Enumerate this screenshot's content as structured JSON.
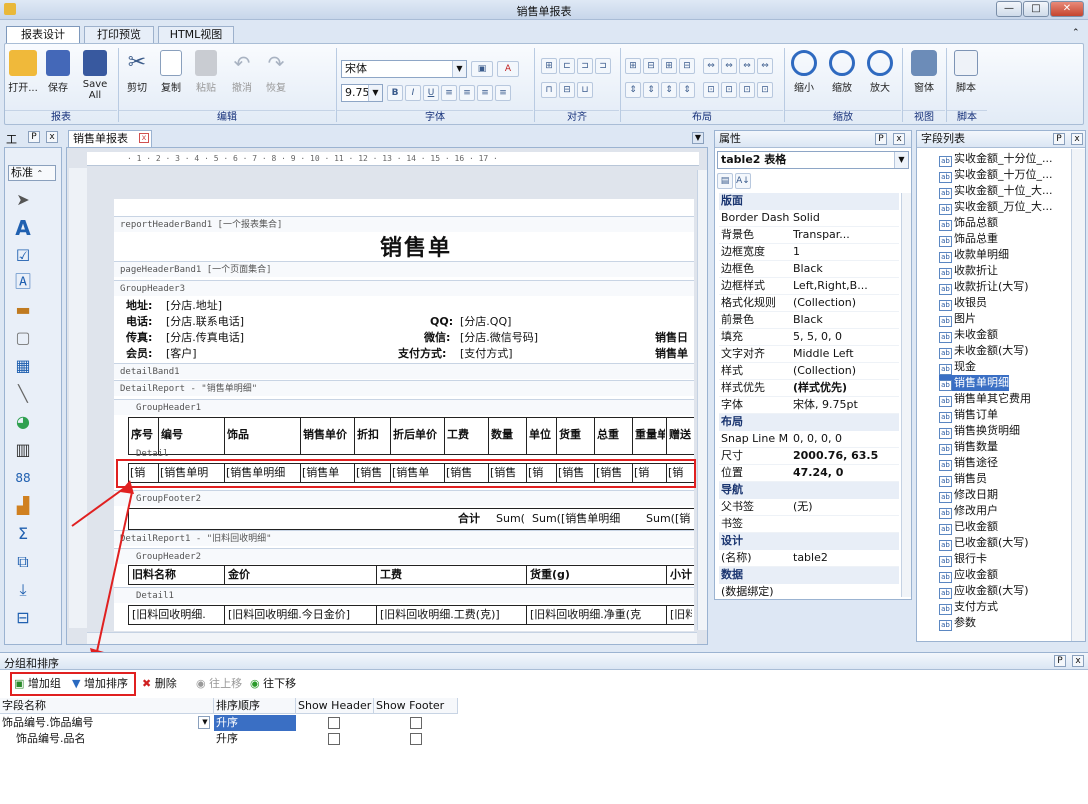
{
  "window": {
    "title": "销售单报表"
  },
  "tabs": [
    "报表设计",
    "打印预览",
    "HTML视图"
  ],
  "ribbon": {
    "open": "打开...",
    "save": "保存",
    "save_all": "Save All",
    "cut": "剪切",
    "copy": "复制",
    "paste": "粘贴",
    "undo": "撤消",
    "redo": "恢复",
    "font_name": "宋体",
    "font_size": "9.75",
    "bold": "B",
    "italic": "I",
    "underline": "U",
    "zoom_out": "缩小",
    "zoom": "缩放",
    "zoom_in": "放大",
    "window_btn": "窗体",
    "script": "脚本",
    "groups": {
      "report": "报表",
      "edit": "编辑",
      "font": "字体",
      "align": "对齐",
      "layout": "布局",
      "zoom": "缩放",
      "view": "视图",
      "script": "脚本"
    }
  },
  "doc_tab": "销售单报表",
  "toolbox": {
    "header": "工",
    "label": "标准"
  },
  "ruler": "· 1 · 2 · 3 · 4 · 5 · 6 · 7 · 8 · 9 · 10 · 11 · 12 · 13 · 14 · 15 · 16 · 17 ·",
  "bands": {
    "report_header": "reportHeaderBand1 [一个报表集合]",
    "page_header": "pageHeaderBand1 [一个页面集合]",
    "group_header3": "GroupHeader3",
    "detail_band": "detailBand1",
    "detail_report": "DetailReport - \"销售单明细\"",
    "group_header1": "GroupHeader1",
    "detail": "Detail",
    "group_footer2": "GroupFooter2",
    "detail_report1": "DetailReport1 - \"旧料回收明细\"",
    "group_header2": "GroupHeader2",
    "detail1": "Detail1"
  },
  "report": {
    "title": "销售单",
    "addr_label": "地址:",
    "addr_val": "[分店.地址]",
    "tel_label": "电话:",
    "tel_val": "[分店.联系电话]",
    "fax_label": "传真:",
    "fax_val": "[分店.传真电话]",
    "member_label": "会员:",
    "member_val": "[客户]",
    "qq_label": "QQ:",
    "qq_val": "[分店.QQ]",
    "wechat_label": "微信:",
    "wechat_val": "[分店.微信号码]",
    "pay_label": "支付方式:",
    "pay_val": "[支付方式]",
    "sale_date": "销售日",
    "sale_no": "销售单",
    "cols": [
      "序号",
      "编号",
      "饰品",
      "销售单价",
      "折扣",
      "折后单价",
      "工费",
      "数量",
      "单位",
      "货重",
      "总重",
      "重量单位",
      "赠送"
    ],
    "detail_cells": [
      "[销",
      "[销售单明",
      "[销售单明细",
      "[销售单",
      "[销售",
      "[销售单",
      "[销售",
      "[销售",
      "[销",
      "[销售",
      "[销售",
      "[销",
      "[销"
    ],
    "total_label": "合计",
    "sum1": "Sum(",
    "sum2": "Sum([销售单明细",
    "sum3": "Sum([销",
    "old_cols": [
      "旧料名称",
      "金价",
      "工费",
      "货重(g)",
      "小计"
    ],
    "old_cells": [
      "[旧料回收明细.",
      "[旧料回收明细.今日金价]",
      "[旧料回收明细.工费(克)]",
      "[旧料回收明细.净重(克",
      "[旧料"
    ]
  },
  "props": {
    "title": "属性",
    "object": "table2 表格",
    "rows": [
      {
        "cat": "版面"
      },
      {
        "k": "Border Dash",
        "v": "Solid"
      },
      {
        "k": "背景色",
        "v": "Transpar..."
      },
      {
        "k": "边框宽度",
        "v": "1"
      },
      {
        "k": "边框色",
        "v": "Black"
      },
      {
        "k": "边框样式",
        "v": "Left,Right,B..."
      },
      {
        "k": "格式化规则",
        "v": "(Collection)"
      },
      {
        "k": "前景色",
        "v": "Black"
      },
      {
        "k": "填充",
        "v": "5, 5, 0, 0"
      },
      {
        "k": "文字对齐",
        "v": "Middle Left"
      },
      {
        "k": "样式",
        "v": "(Collection)"
      },
      {
        "k": "样式优先",
        "v": "(样式优先)"
      },
      {
        "k": "字体",
        "v": "宋体, 9.75pt"
      },
      {
        "cat": "布局"
      },
      {
        "k": "Snap Line M",
        "v": "0, 0, 0, 0"
      },
      {
        "k": "尺寸",
        "v": "2000.76, 63.5"
      },
      {
        "k": "位置",
        "v": "47.24, 0"
      },
      {
        "cat": "导航"
      },
      {
        "k": "父书签",
        "v": "(无)"
      },
      {
        "k": "书签",
        "v": ""
      },
      {
        "cat": "设计"
      },
      {
        "k": "(名称)",
        "v": "table2"
      },
      {
        "cat": "数据"
      },
      {
        "k": "(数据绑定)",
        "v": ""
      }
    ]
  },
  "fields": {
    "title": "字段列表",
    "items": [
      "实收金额_十分位_...",
      "实收金额_十万位_...",
      "实收金额_十位_大...",
      "实收金额_万位_大...",
      "饰品总额",
      "饰品总重",
      "收款单明细",
      "收款折让",
      "收款折让(大写)",
      "收银员",
      "图片",
      "未收金额",
      "未收金额(大写)",
      "现金",
      "销售单明细",
      "销售单其它费用",
      "销售订单",
      "销售换货明细",
      "销售数量",
      "销售途径",
      "销售员",
      "修改日期",
      "修改用户",
      "已收金额",
      "已收金额(大写)",
      "银行卡",
      "应收金额",
      "应收金额(大写)",
      "支付方式",
      "参数"
    ]
  },
  "grouping": {
    "title": "分组和排序",
    "add_group": "增加组",
    "add_sort": "增加排序",
    "delete": "删除",
    "move_up": "往上移",
    "move_down": "往下移",
    "headers": [
      "字段名称",
      "排序顺序",
      "Show Header",
      "Show Footer"
    ],
    "rows": [
      {
        "field": "饰品编号.饰品编号",
        "order": "升序"
      },
      {
        "field": "饰品编号.品名",
        "order": "升序"
      }
    ]
  },
  "colors": {
    "accent": "#3a6fc4",
    "highlight": "#e02020"
  }
}
